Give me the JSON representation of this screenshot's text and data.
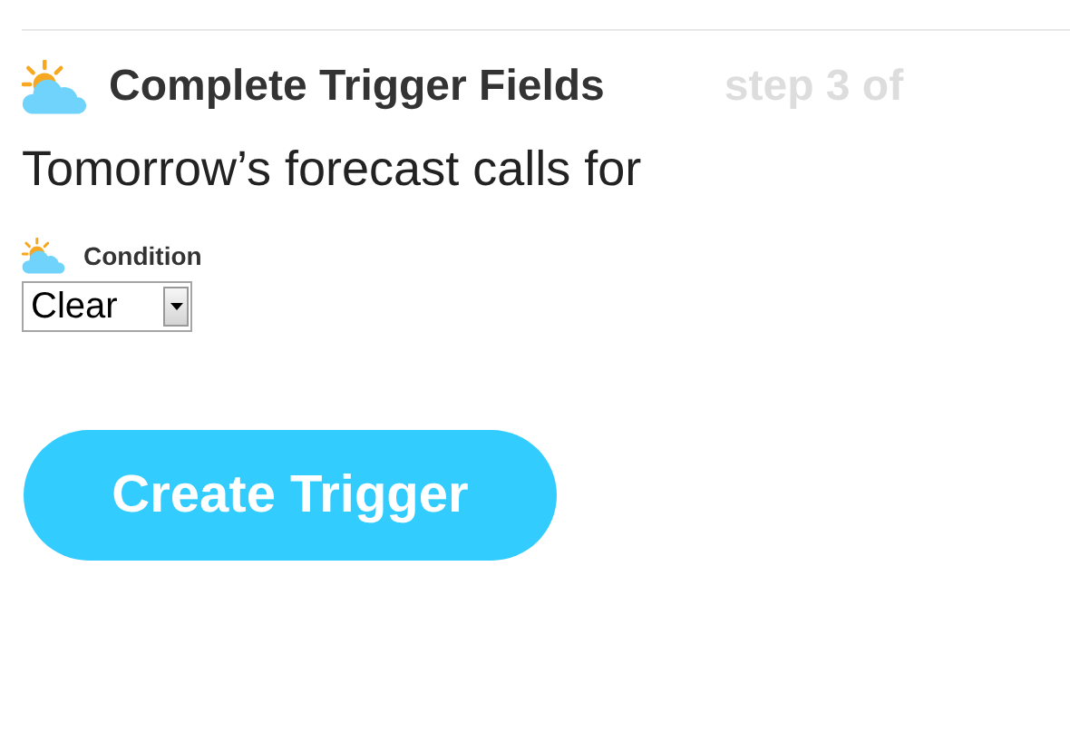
{
  "header": {
    "title": "Complete Trigger Fields",
    "step": "step 3 of"
  },
  "prompt": "Tomorrow’s forecast calls for",
  "field": {
    "label": "Condition",
    "value": "Clear"
  },
  "button": "Create Trigger"
}
